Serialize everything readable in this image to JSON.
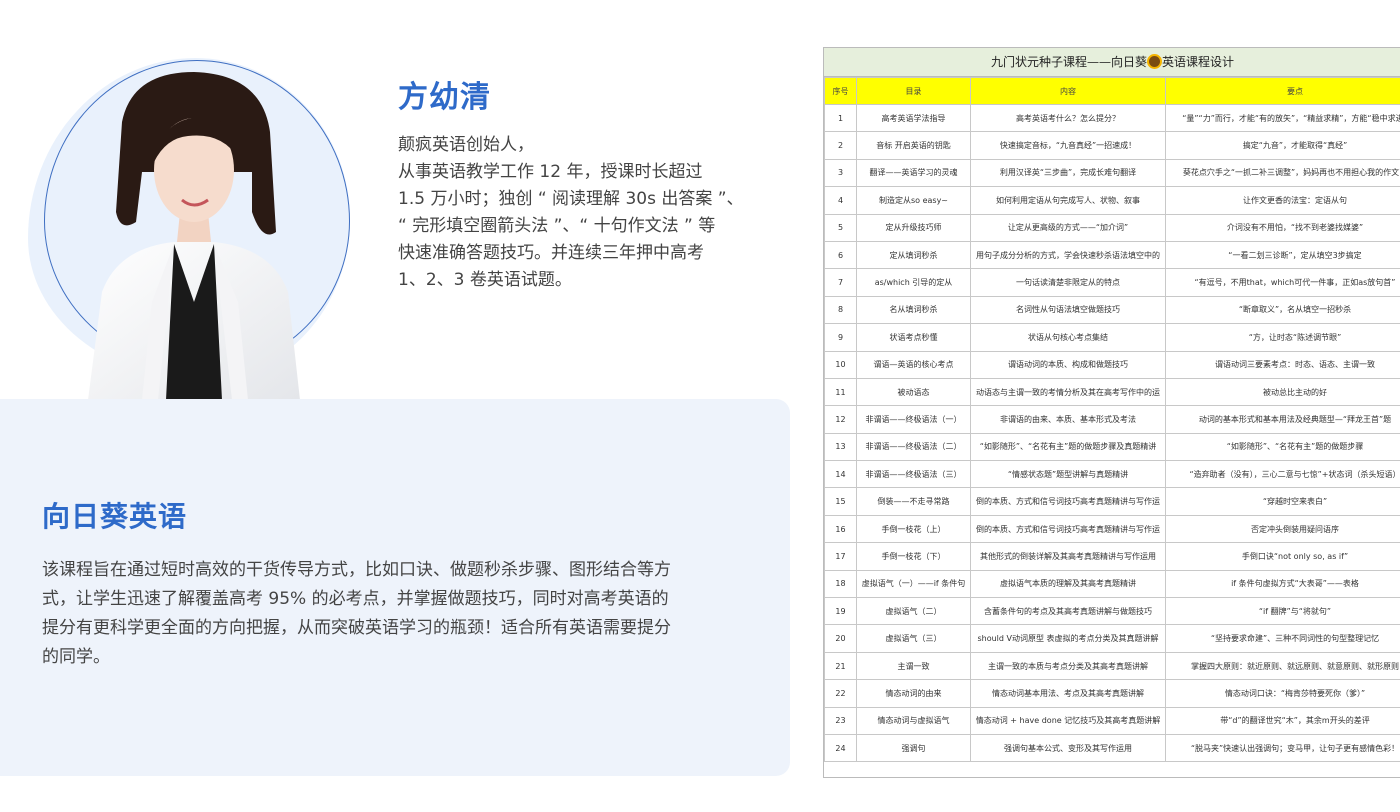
{
  "teacher": {
    "name": "方幼清",
    "bio_lines": [
      "颠疯英语创始人，",
      "从事英语教学工作 12 年，授课时长超过",
      "1.5 万小时；独创 “ 阅读理解 30s 出答案 ”、",
      "“ 完形填空圈箭头法 ”、“ 十句作文法 ” 等",
      "快速准确答题技巧。并连续三年押中高考",
      "1、2、3 卷英语试题。"
    ]
  },
  "course": {
    "title": "向日葵英语",
    "desc_lines": [
      "该课程旨在通过短时高效的干货传导方式，比如口诀、做题秒杀步骤、图形结合等方",
      "式，让学生迅速了解覆盖高考 95% 的必考点，并掌握做题技巧，同时对高考英语的",
      "提分有更科学更全面的方向把握，从而突破英语学习的瓶颈！适合所有英语需要提分",
      "的同学。"
    ]
  },
  "syllabus": {
    "title_before": "九门状元种子课程——向日葵",
    "title_after": "英语课程设计",
    "headers": [
      "序号",
      "目录",
      "内容",
      "要点"
    ],
    "rows": [
      [
        "1",
        "高考英语学法指导",
        "高考英语考什么？怎么提分？",
        "“量”“力”而行，才能“有的放矢”，“精益求精”，方能“稳中求进”"
      ],
      [
        "2",
        "音标    开启英语的钥匙",
        "快速搞定音标，“九音真经”一招速成！",
        "搞定“九音”，才能取得“真经”"
      ],
      [
        "3",
        "翻译——英语学习的灵魂",
        "利用汉译英“三步曲”，完成长难句翻译",
        "葵花点穴手之“一抓二补三调整”，妈妈再也不用担心我的作文了"
      ],
      [
        "4",
        "制造定从so easy~",
        "如何利用定语从句完成写人、状物、叙事",
        "让作文更香的法宝：定语从句"
      ],
      [
        "5",
        "定从升级技巧师",
        "让定从更高级的方式——“加介词”",
        "介词没有不用怕，“找不到老婆找媒婆”"
      ],
      [
        "6",
        "定从填词秒杀",
        "用句子成分分析的方式，学会快速秒杀语法填空中的",
        "“一看二划三诊断”，定从填空3步搞定"
      ],
      [
        "7",
        "as/which 引导的定从",
        "一句话读清楚非限定从的特点",
        "“有逗号，不用that，which可代一件事，正如as放句首”"
      ],
      [
        "8",
        "名从填词秒杀",
        "名词性从句语法填空做题技巧",
        "“断章取义”，名从填空一招秒杀"
      ],
      [
        "9",
        "状语考点秒懂",
        "状语从句核心考点集结",
        "“方，让时态“陈述调节眼”"
      ],
      [
        "10",
        "谓语—英语的核心考点",
        "谓语动词的本质、构成和做题技巧",
        "谓语动词三要素考点：时态、语态、主谓一致"
      ],
      [
        "11",
        "被动语态",
        "动语态与主谓一致的考情分析及其在高考写作中的运",
        "被动总比主动的好"
      ],
      [
        "12",
        "非谓语——终极语法（一）",
        "非谓语的由来、本质、基本形式及考法",
        "动词的基本形式和基本用法及经典题型—“拜龙王首”题"
      ],
      [
        "13",
        "非谓语——终极语法（二）",
        "“如影随形”、“名花有主”题的做题步骤及真题精讲",
        "“如影随形”、“名花有主”题的做题步骤"
      ],
      [
        "14",
        "非谓语——终极语法（三）",
        "“情感状态题”题型讲解与真题精讲",
        "“造弃助者（没有），三心二意与七惊”+状态词（杀头短语）"
      ],
      [
        "15",
        "倒装——不走寻常路",
        "倒的本质、方式和信号词技巧高考真题精讲与写作运",
        "“穿越时空来表白”"
      ],
      [
        "16",
        "手倒一枝花（上）",
        "倒的本质、方式和信号词技巧高考真题精讲与写作运",
        "否定冲头倒装用疑问语序"
      ],
      [
        "17",
        "手倒一枝花（下）",
        "其他形式的倒装详解及其高考真题精讲与写作运用",
        "手倒口诀“not only so, as if”"
      ],
      [
        "18",
        "虚拟语气（一）——if 条件句",
        "虚拟语气本质的理解及其高考真题精讲",
        "if 条件句虚拟方式“大表哥”——表格"
      ],
      [
        "19",
        "虚拟语气（二）",
        "含蓄条件句的考点及其高考真题讲解与做题技巧",
        "“if 翻牌”与“将就句”"
      ],
      [
        "20",
        "虚拟语气（三）",
        "should V动词原型 表虚拟的考点分类及其真题讲解",
        "“坚持要求命建”、三种不同词性的句型整理记忆"
      ],
      [
        "21",
        "主谓一致",
        "主谓一致的本质与考点分类及其高考真题讲解",
        "掌握四大原则：就近原则、就远原则、就意原则、就形原则"
      ],
      [
        "22",
        "情态动词的由来",
        "情态动词基本用法、考点及其高考真题讲解",
        "情态动词口诀：“梅肯莎特要死你（爹）”"
      ],
      [
        "23",
        "情态动词与虚拟语气",
        "情态动词 + have done 记忆技巧及其高考真题讲解",
        "带“d”的翻译世究“木”，其余m开头的差评"
      ],
      [
        "24",
        "强调句",
        "强调句基本公式、变形及其写作运用",
        "“脱马夹”快速认出强调句；变马甲，让句子更有感情色彩！"
      ]
    ]
  },
  "colors": {
    "accent_blue": "#2e6ac9",
    "panel_bg": "#eef3fb",
    "table_header": "#ffff00",
    "table_title_bg": "#e6efdc"
  }
}
